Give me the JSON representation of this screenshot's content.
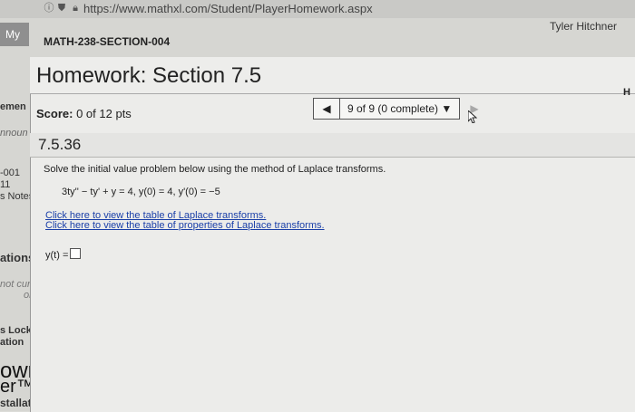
{
  "browser": {
    "url": "https://www.mathxl.com/Student/PlayerHomework.aspx",
    "icons": [
      "info-icon",
      "shield-icon",
      "lock-icon"
    ]
  },
  "header": {
    "my_tab": "My",
    "user_name": "Tyler Hitchner",
    "course": "MATH-238-SECTION-004"
  },
  "sidebar_fragments": [
    "emen",
    "nnoun",
    "-001",
    "11",
    "s Notes",
    "ations",
    "not curr",
    "or",
    "s Lockd",
    "ation",
    "own",
    "er™",
    "stallati"
  ],
  "homework": {
    "title": "Homework: Section 7.5",
    "right_fragment": "H",
    "score_label": "Score:",
    "score_value": "0 of 12 pts",
    "progress": "9 of 9 (0 complete) ▼",
    "prev_icon": "◀",
    "next_icon": "▶"
  },
  "question": {
    "number": "7.5.36",
    "prompt": "Solve the initial value problem below using the method of Laplace transforms.",
    "equation": "3ty'' − ty' + y = 4,  y(0) = 4,  y'(0) = −5",
    "link1": "Click here to view the table of Laplace transforms.",
    "link2": "Click here to view the table of properties of Laplace transforms.",
    "answer_label": "y(t) ="
  }
}
